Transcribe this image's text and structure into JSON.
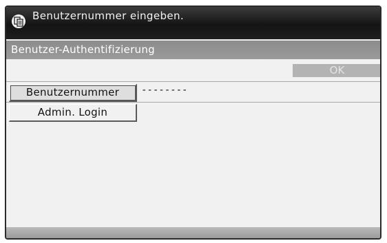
{
  "message": {
    "icon": "copy-icon",
    "text": "Benutzernummer eingeben."
  },
  "screen_title": "Benutzer-Authentifizierung",
  "ok_label": "OK",
  "user_number": {
    "button_label": "Benutzernummer",
    "value": "--------"
  },
  "admin_login_label": "Admin. Login"
}
